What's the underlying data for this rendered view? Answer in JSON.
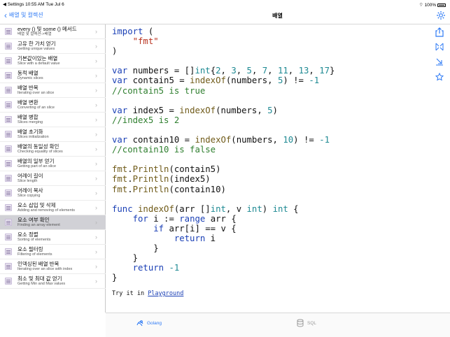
{
  "status": {
    "left": "◀ Settings  10:55 AM  Tue Jul 6",
    "right": "100%"
  },
  "nav": {
    "back_label": "배열 및 컬렉션",
    "title": "배열"
  },
  "sidebar": {
    "items": [
      {
        "title": "every () 및 some () 메서드",
        "subtitle": "배열 및 컬렉션->배열",
        "selected": false
      },
      {
        "title": "고유 한 가치 얻기",
        "subtitle": "Getting unique values",
        "selected": false
      },
      {
        "title": "기본값이있는 배열",
        "subtitle": "Slice with a default value",
        "selected": false
      },
      {
        "title": "동적 배열",
        "subtitle": "Dynamic slices",
        "selected": false
      },
      {
        "title": "배열 반복",
        "subtitle": "Iterating over an slice",
        "selected": false
      },
      {
        "title": "배열 변환",
        "subtitle": "Converting of an slice",
        "selected": false
      },
      {
        "title": "배열 병합",
        "subtitle": "Slices merging",
        "selected": false
      },
      {
        "title": "배열 초기화",
        "subtitle": "Slices initialization",
        "selected": false
      },
      {
        "title": "배열의 동일성 확인",
        "subtitle": "Checking equality of slices",
        "selected": false
      },
      {
        "title": "배열의 일부 얻기",
        "subtitle": "Getting part of an slice",
        "selected": false
      },
      {
        "title": "어레이 길이",
        "subtitle": "Slice length",
        "selected": false
      },
      {
        "title": "어레이 복사",
        "subtitle": "Slice copying",
        "selected": false
      },
      {
        "title": "요소 삽입 및 삭제",
        "subtitle": "Adding and removing of elements",
        "selected": false
      },
      {
        "title": "요소 여부 확인",
        "subtitle": "Finding an array element",
        "selected": true
      },
      {
        "title": "요소 정렬",
        "subtitle": "Sorting of elements",
        "selected": false
      },
      {
        "title": "요소 필터링",
        "subtitle": "Filtering of elements",
        "selected": false
      },
      {
        "title": "인덱싱된 배열 반복",
        "subtitle": "Iterating over an slice with index",
        "selected": false
      },
      {
        "title": "최소 및 최대 값 얻기",
        "subtitle": "Getting Min and Max values",
        "selected": false
      }
    ]
  },
  "code": {
    "try_prefix": "Try it in ",
    "try_link": "Playground"
  },
  "tabs": {
    "golang": "Golang",
    "sql": "SQL"
  },
  "colors": {
    "accent": "#2f7bf5",
    "selected_row": "#d1d1d6"
  }
}
